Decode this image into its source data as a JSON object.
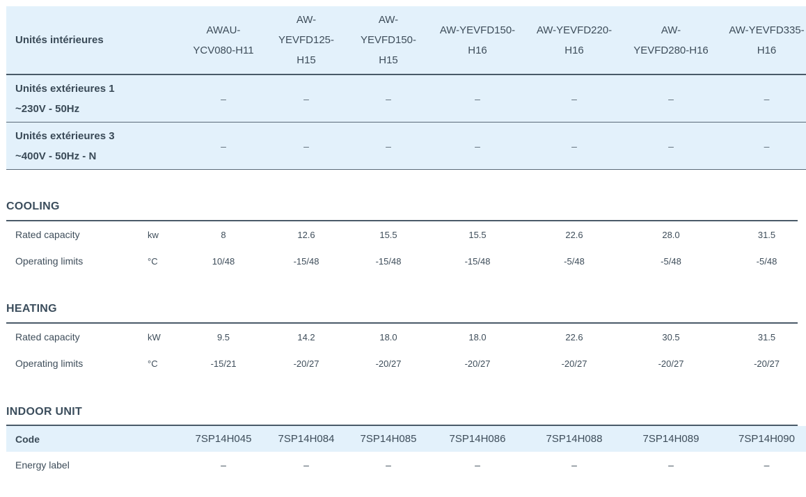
{
  "header": {
    "label": "Unités intérieures",
    "models": [
      [
        "AWAU-",
        "YCV080-H11"
      ],
      [
        "AW-",
        "YEVFD125-",
        "H15"
      ],
      [
        "AW-",
        "YEVFD150-",
        "H15"
      ],
      [
        "AW-YEVFD150-",
        "H16"
      ],
      [
        "AW-YEVFD220-",
        "H16"
      ],
      [
        "AW-",
        "YEVFD280-H16"
      ],
      [
        "AW-YEVFD335-",
        "H16"
      ]
    ]
  },
  "outdoor_rows": [
    {
      "label_line1": "Unités extérieures 1",
      "label_line2": "~230V - 50Hz",
      "values": [
        "–",
        "–",
        "–",
        "–",
        "–",
        "–",
        "–"
      ]
    },
    {
      "label_line1": "Unités extérieures 3",
      "label_line2": "~400V - 50Hz - N",
      "values": [
        "–",
        "–",
        "–",
        "–",
        "–",
        "–",
        "–"
      ]
    }
  ],
  "cooling": {
    "title": "COOLING",
    "rows": [
      {
        "label": "Rated capacity",
        "unit": "kw",
        "values": [
          "8",
          "12.6",
          "15.5",
          "15.5",
          "22.6",
          "28.0",
          "31.5"
        ]
      },
      {
        "label": "Operating limits",
        "unit": "°C",
        "values": [
          "10/48",
          "-15/48",
          "-15/48",
          "-15/48",
          "-5/48",
          "-5/48",
          "-5/48"
        ]
      }
    ]
  },
  "heating": {
    "title": "HEATING",
    "rows": [
      {
        "label": "Rated capacity",
        "unit": "kW",
        "values": [
          "9.5",
          "14.2",
          "18.0",
          "18.0",
          "22.6",
          "30.5",
          "31.5"
        ]
      },
      {
        "label": "Operating limits",
        "unit": "°C",
        "values": [
          "-15/21",
          "-20/27",
          "-20/27",
          "-20/27",
          "-20/27",
          "-20/27",
          "-20/27"
        ]
      }
    ]
  },
  "indoor_unit": {
    "title": "INDOOR UNIT",
    "code_label": "Code",
    "codes": [
      "7SP14H045",
      "7SP14H084",
      "7SP14H085",
      "7SP14H086",
      "7SP14H088",
      "7SP14H089",
      "7SP14H090"
    ],
    "energy_label": "Energy label",
    "energy_values": [
      "–",
      "–",
      "–",
      "–",
      "–",
      "–",
      "–"
    ]
  },
  "colors": {
    "header_bg": "#e3f1fb",
    "text": "#3e4d5a",
    "rule": "#4a5a68"
  }
}
